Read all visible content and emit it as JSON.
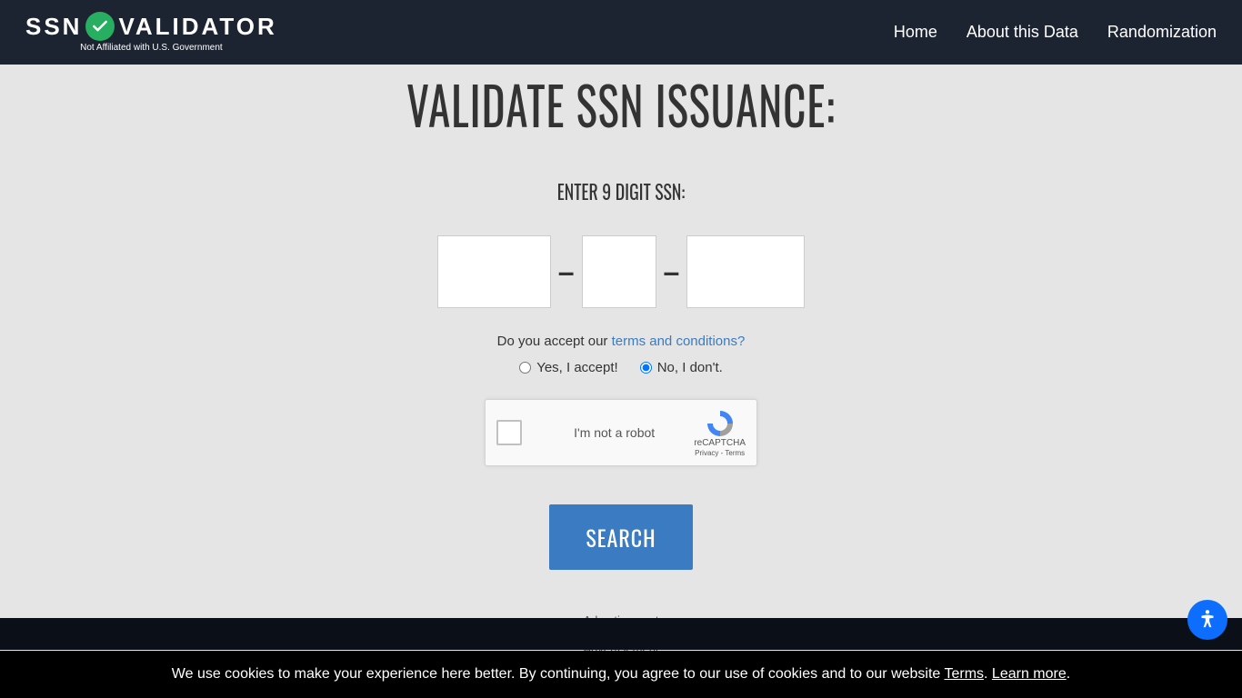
{
  "header": {
    "logo_left": "SSN",
    "logo_right": "VALIDATOR",
    "subtext": "Not Affiliated with U.S. Government",
    "nav": [
      "Home",
      "About this Data",
      "Randomization"
    ]
  },
  "main": {
    "title": "VALIDATE SSN ISSUANCE:",
    "subtitle": "ENTER 9 DIGIT SSN:",
    "dash": "–",
    "terms_prefix": "Do you accept our ",
    "terms_link": "terms and conditions?",
    "accept_label": "Yes, I accept!",
    "reject_label": "No, I don't.",
    "recaptcha_label": "I'm not a robot",
    "recaptcha_brand": "reCAPTCHA",
    "recaptcha_links": "Privacy - Terms",
    "search_label": "SEARCH",
    "ad1": "Advertisement",
    "ad2": "Advertisement"
  },
  "cookie": {
    "text_prefix": "We use cookies to make your experience here better. By continuing, you agree to our use of cookies and to our website ",
    "terms": "Terms",
    "sep": ". ",
    "learn": "Learn more",
    "end": "."
  }
}
